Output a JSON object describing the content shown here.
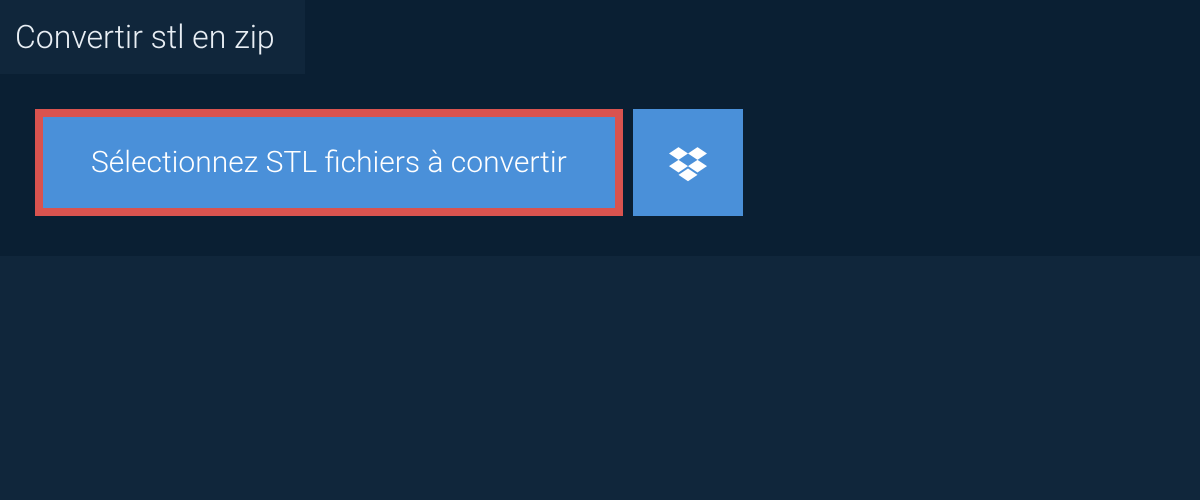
{
  "header": {
    "title": "Convertir stl en zip"
  },
  "actions": {
    "select_files_label": "Sélectionnez STL fichiers à convertir",
    "dropbox_icon": "dropbox-icon"
  },
  "colors": {
    "bg_outer": "#10263b",
    "bg_panel": "#0a1f33",
    "button_bg": "#4a90d9",
    "highlight_border": "#d9534f"
  }
}
